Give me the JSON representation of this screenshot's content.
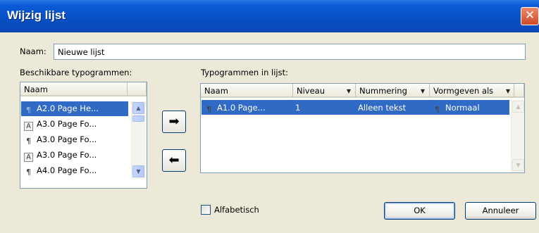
{
  "window": {
    "title": "Wijzig lijst",
    "close_glyph": "✕"
  },
  "name_field": {
    "label": "Naam:",
    "value": "Nieuwe lijst"
  },
  "available": {
    "label": "Beschikbare typogrammen:",
    "column": "Naam",
    "items": [
      {
        "label": "A2.0 Page He...",
        "icon": "paragraph-style-icon",
        "selected": true
      },
      {
        "label": "A3.0 Page Fo...",
        "icon": "character-style-icon",
        "selected": false
      },
      {
        "label": "A3.0 Page Fo...",
        "icon": "paragraph-style-icon",
        "selected": false
      },
      {
        "label": "A3.0 Page Fo...",
        "icon": "character-style-icon",
        "selected": false
      },
      {
        "label": "A4.0 Page Fo...",
        "icon": "paragraph-style-icon",
        "selected": false
      }
    ]
  },
  "move_buttons": {
    "add_glyph": "➡",
    "remove_glyph": "⬅"
  },
  "in_list": {
    "label": "Typogrammen in lijst:",
    "columns": [
      "Naam",
      "Niveau",
      "Nummering",
      "Vormgeven als"
    ],
    "rows": [
      {
        "name": "A1.0 Page...",
        "level": "1",
        "numbering": "Alleen tekst",
        "format_as": "Normaal",
        "selected": true
      }
    ]
  },
  "alphabetical": {
    "label": "Alfabetisch",
    "checked": false
  },
  "buttons": {
    "ok": "OK",
    "cancel": "Annuleer"
  }
}
